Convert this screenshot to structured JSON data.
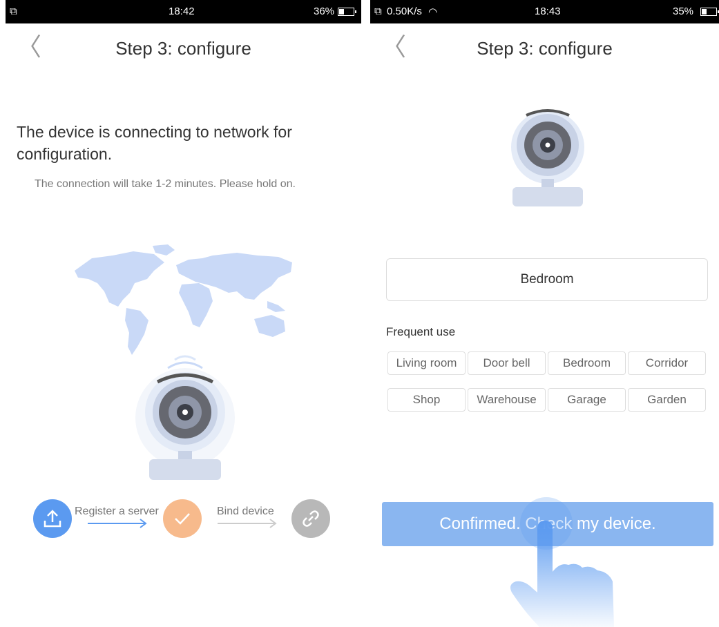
{
  "left_screen": {
    "status_bar": {
      "time": "18:42",
      "battery": "36%",
      "battery_level": 0.36
    },
    "title": "Step 3: configure",
    "heading": "The device is connecting to network for configuration.",
    "subheading": "The connection will take 1-2 minutes. Please hold on.",
    "steps": [
      {
        "label": "Register a server",
        "icon": "upload-icon",
        "color": "#5b9af0"
      },
      {
        "label": "Bind device",
        "icon": "check-icon",
        "color": "#f7ba8c"
      },
      {
        "label": "",
        "icon": "link-icon",
        "color": "#b8b8b8"
      }
    ]
  },
  "right_screen": {
    "status_bar": {
      "speed": "0.50K/s",
      "time": "18:43",
      "battery": "35%",
      "battery_level": 0.35
    },
    "title": "Step 3: configure",
    "device_name_value": "Bedroom",
    "frequent_use_label": "Frequent use",
    "frequent_use_options": [
      "Living room",
      "Door bell",
      "Bedroom",
      "Corridor",
      "Shop",
      "Warehouse",
      "Garage",
      "Garden"
    ],
    "confirm_button_label": "Confirmed. Check my device."
  },
  "colors": {
    "accent_blue": "#5b9af0",
    "button_blue": "#8ab6f0",
    "map_blue": "#c9d9f7",
    "step_orange": "#f7ba8c"
  }
}
